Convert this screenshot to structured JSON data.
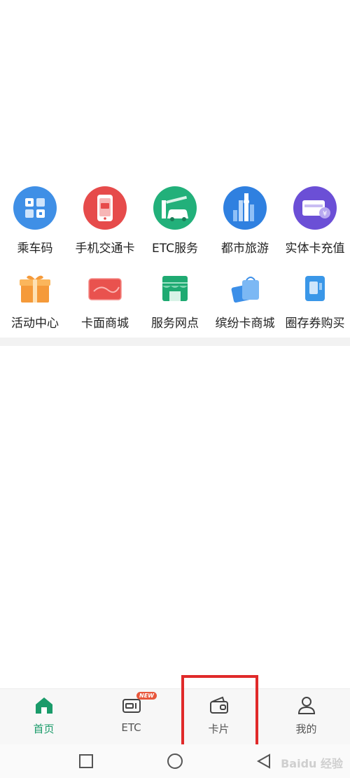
{
  "services": {
    "row1": [
      {
        "label": "乘车码",
        "icon": "qr-code-icon"
      },
      {
        "label": "手机交通卡",
        "icon": "phone-transit-card-icon"
      },
      {
        "label": "ETC服务",
        "icon": "etc-gate-icon"
      },
      {
        "label": "都市旅游",
        "icon": "city-skyline-icon"
      },
      {
        "label": "实体卡充值",
        "icon": "card-recharge-icon"
      }
    ],
    "row2": [
      {
        "label": "活动中心",
        "icon": "gift-box-icon"
      },
      {
        "label": "卡面商城",
        "icon": "card-face-icon"
      },
      {
        "label": "服务网点",
        "icon": "service-outlet-icon"
      },
      {
        "label": "缤纷卡商城",
        "icon": "shopping-bag-icon"
      },
      {
        "label": "圈存券购买",
        "icon": "voucher-icon"
      }
    ]
  },
  "tabbar": {
    "home": "首页",
    "etc": "ETC",
    "etc_badge": "NEW",
    "cards": "卡片",
    "mine": "我的"
  },
  "watermark": "Baidu 经验",
  "colors": {
    "accent": "#1a9b6a",
    "highlight": "#e02a2a"
  }
}
